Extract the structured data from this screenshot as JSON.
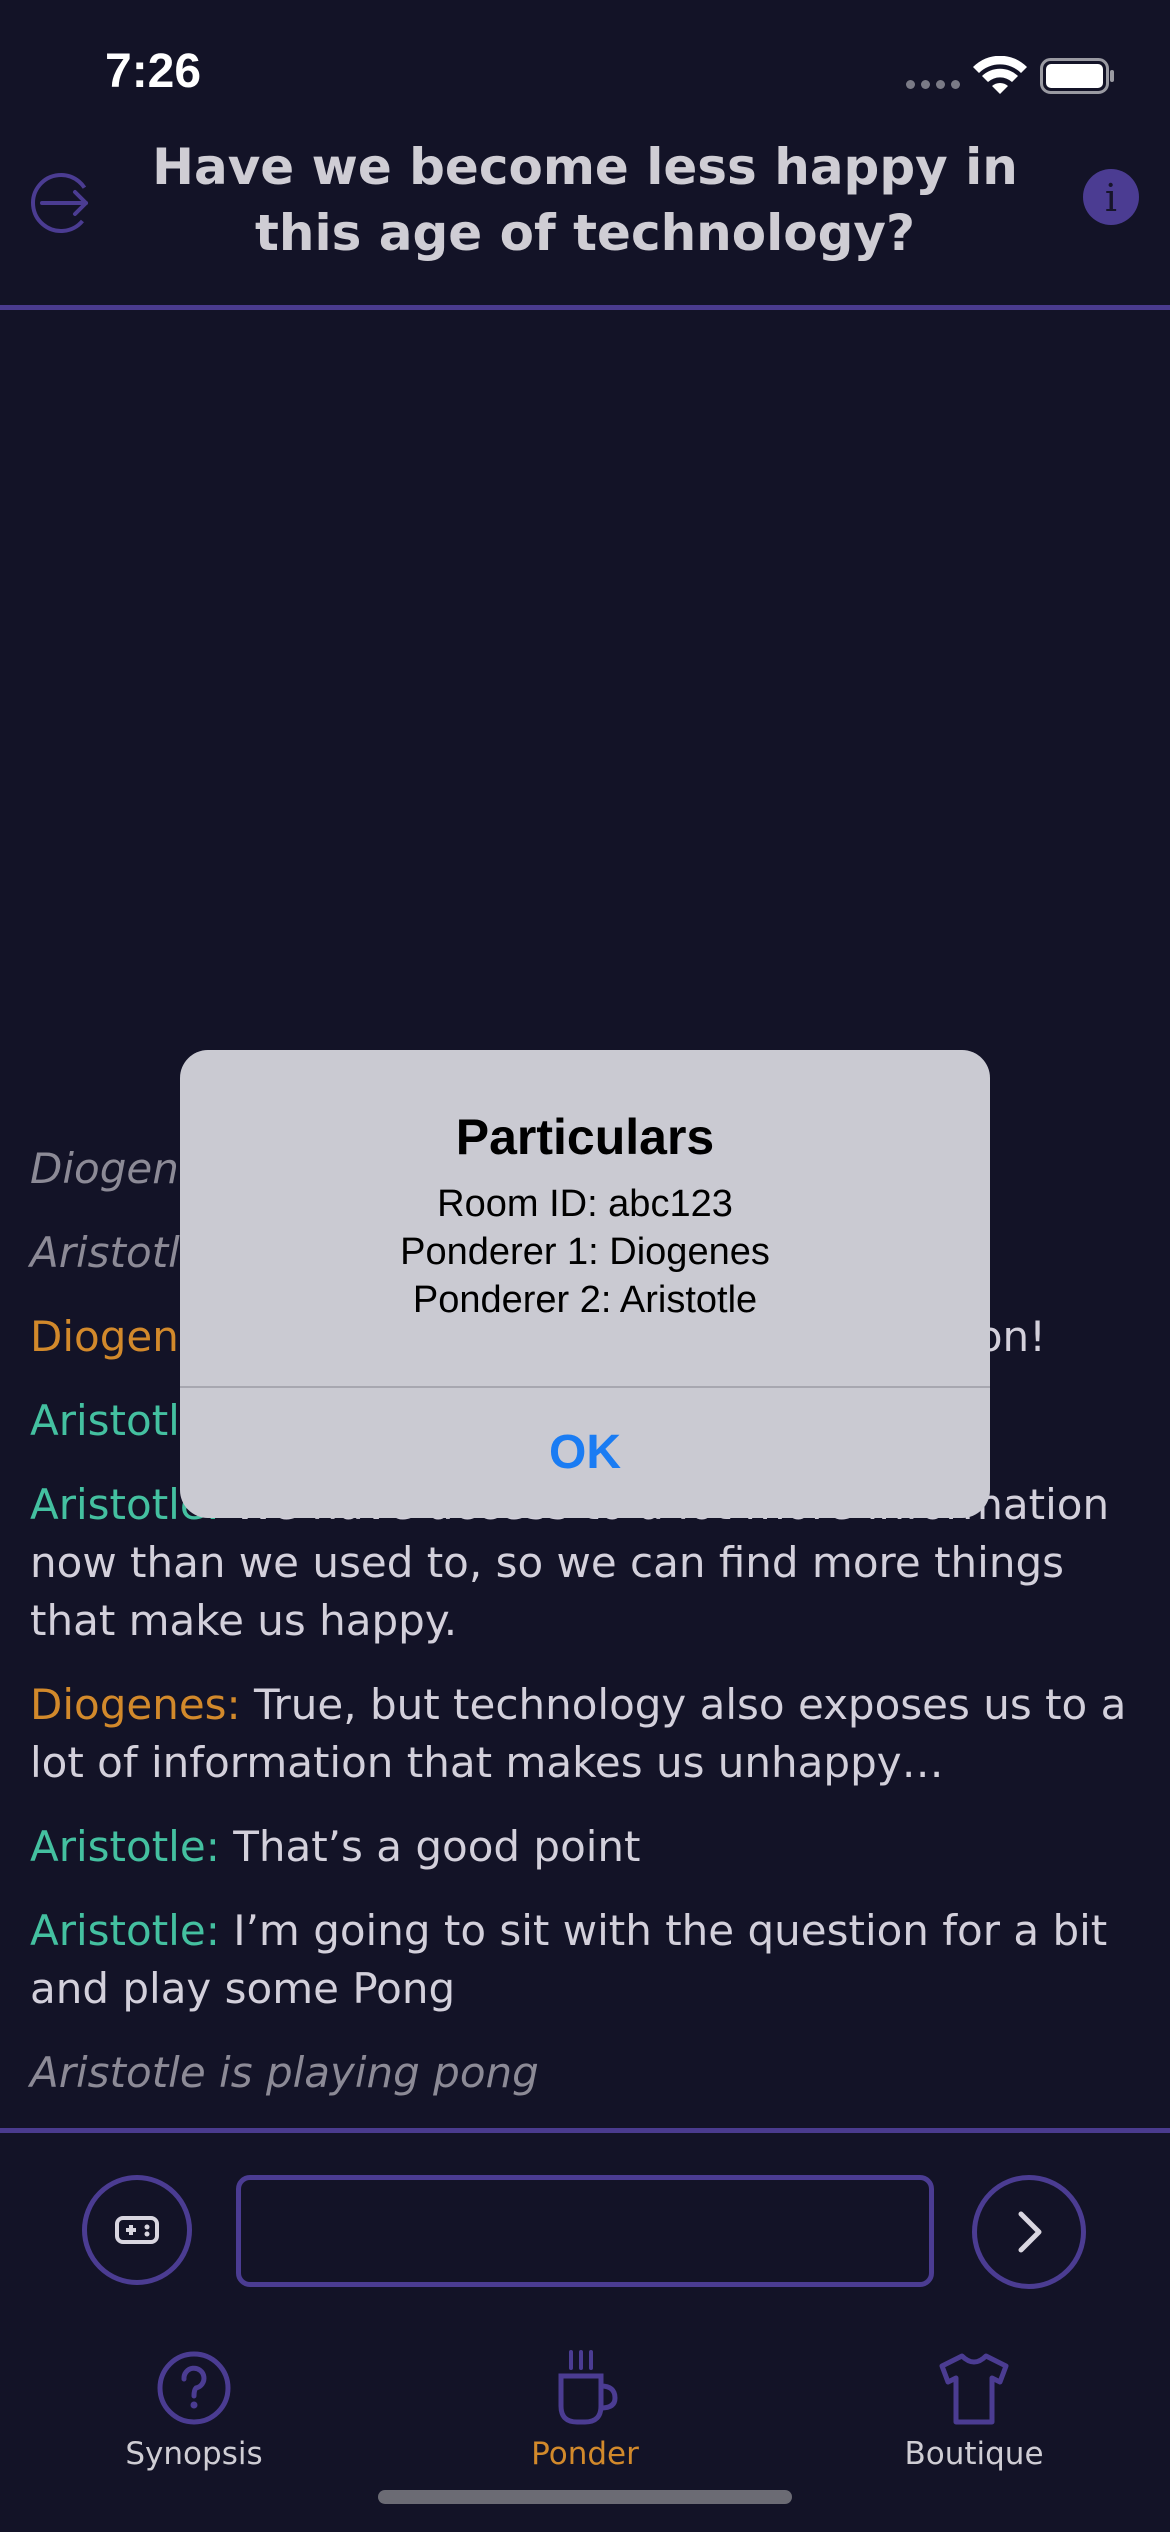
{
  "status_bar": {
    "time": "7:26"
  },
  "header": {
    "title": "Have we become less happy in this age of technology?"
  },
  "chat": {
    "messages": [
      {
        "text": "Diogenes",
        "italic": true
      },
      {
        "text": "Aristotle",
        "italic": true
      },
      {
        "speaker": "Diogenes",
        "text": "on!"
      },
      {
        "speaker": "Aristotle",
        "text": ""
      },
      {
        "speaker": "Aristotle:",
        "text": " We have access to a lot more information now than we used to, so we can find more things that make us happy."
      },
      {
        "speaker": "Diogenes:",
        "text": " True, but technology also exposes us to a lot of information that makes us unhappy…"
      },
      {
        "speaker": "Aristotle:",
        "text": " That’s a good point"
      },
      {
        "speaker": "Aristotle:",
        "text": " I’m going to sit with the question for a bit and play some Pong"
      }
    ],
    "status_line": "Aristotle is playing pong"
  },
  "composer": {
    "value": ""
  },
  "tabs": [
    {
      "label": "Synopsis",
      "icon": "question-circle-icon",
      "active": false
    },
    {
      "label": "Ponder",
      "icon": "coffee-cup-icon",
      "active": true
    },
    {
      "label": "Boutique",
      "icon": "tshirt-icon",
      "active": false
    }
  ],
  "alert": {
    "title": "Particulars",
    "lines": [
      "Room ID: abc123",
      "Ponderer 1: Diogenes",
      "Ponderer 2: Aristotle"
    ],
    "ok_label": "OK"
  },
  "colors": {
    "background": "#131327",
    "accent": "#4b3c92",
    "diogenes": "#d2892b",
    "aristotle": "#44c0a0",
    "link_blue": "#1a7cf3"
  }
}
